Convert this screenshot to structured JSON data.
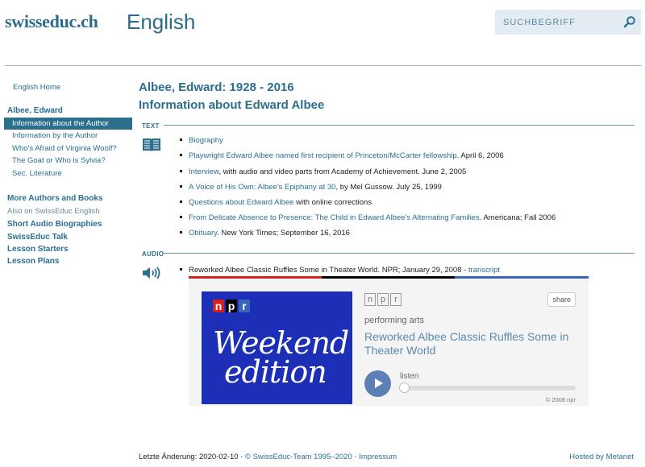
{
  "header": {
    "logo": "swisseduc.ch",
    "language": "English",
    "search_placeholder": "SUCHBEGRIFF"
  },
  "sidebar": {
    "home": "English Home",
    "section_title": "Albee, Edward",
    "items": [
      {
        "label": "Information about the Author",
        "active": true
      },
      {
        "label": "Information by the Author",
        "active": false
      },
      {
        "label": "Who's Afraid of Virginia Woolf?",
        "active": false
      },
      {
        "label": "The Goat or Who is Sylvia?",
        "active": false
      },
      {
        "label": "Sec. Literature",
        "active": false
      }
    ],
    "more_authors": "More Authors and Books",
    "also_on": "Also on SwissEduc English",
    "links": [
      "Short Audio Biographies",
      "SwissEduc Talk",
      "Lesson Starters",
      "Lesson Plans"
    ]
  },
  "main": {
    "title_line1": "Albee, Edward: 1928 - 2016",
    "title_line2": "Information about Edward Albee",
    "text_label": "TEXT",
    "audio_label": "AUDIO",
    "references": [
      {
        "link": "Biography",
        "rest": ""
      },
      {
        "link": "Playwright Edward Albee named first recipient of Princeton/McCarter fellowship",
        "rest": ". April 6, 2006"
      },
      {
        "link": "Interview",
        "rest": ", with audio and video parts from Academy of Achievement. June 2, 2005"
      },
      {
        "link": "A Voice of His Own: Albee's Epiphany at 30",
        "rest": ", by Mel Gussow. July 25, 1999"
      },
      {
        "link": "Questions about Edward Albee",
        "rest": " with online corrections"
      },
      {
        "link": "From Delicate Absence to Presence: The Child in Edward Albee's Alternating Families",
        "rest": ". Americana; Fall 2006"
      },
      {
        "link": "Obituary",
        "rest": ". New York Times; September 16, 2016"
      }
    ],
    "audio": {
      "text": "Reworked Albee Classic Ruffles Some in Theater World. NPR; January 29, 2008 - ",
      "link": "transcript"
    }
  },
  "npr_player": {
    "logo_letters": [
      "n",
      "p",
      "r"
    ],
    "art_text_line1": "Weekend",
    "art_text_line2": "edition",
    "share_label": "share",
    "program": "performing arts",
    "story_title": "Reworked Albee Classic Ruffles Some in Theater World",
    "listen_label": "listen",
    "progress": 0,
    "copyright": "© 2008 npr",
    "colors": {
      "red": "#d62021",
      "black": "#000000",
      "blue": "#3a64b8",
      "art_bg": "#1e2fb7"
    }
  },
  "footer": {
    "last_change": "Letzte Änderung: 2020-02-10 · ",
    "team_link": "© SwissEduc-Team 1995–2020",
    "sep": " · ",
    "impressum": "Impressum",
    "hosted": "Hosted by Metanet"
  }
}
